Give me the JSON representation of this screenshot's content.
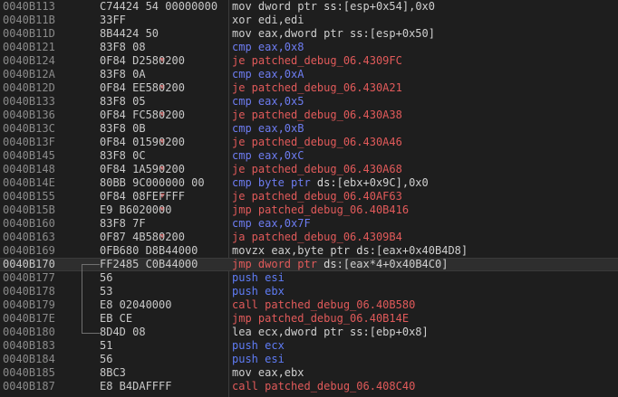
{
  "rows": [
    {
      "addr": "0040B113",
      "bytes": "C74424 54 00000000",
      "asm": [
        [
          "t-mn",
          "mov dword ptr "
        ],
        [
          "t-seg",
          "ss:"
        ],
        [
          "t-op",
          "[esp+0x54]"
        ],
        [
          "t-op",
          ",0x0"
        ]
      ]
    },
    {
      "addr": "0040B11B",
      "bytes": "33FF",
      "asm": [
        [
          "t-mn",
          "xor edi,edi"
        ]
      ]
    },
    {
      "addr": "0040B11D",
      "bytes": "8B4424 50",
      "asm": [
        [
          "t-mn",
          "mov eax,dword ptr "
        ],
        [
          "t-seg",
          "ss:"
        ],
        [
          "t-op",
          "[esp+0x50]"
        ]
      ]
    },
    {
      "addr": "0040B121",
      "bytes": "83F8 08",
      "asm": [
        [
          "t-cmp",
          "cmp eax,0x8"
        ]
      ]
    },
    {
      "addr": "0040B124",
      "bytes": "0F84 D2580200",
      "jcc": true,
      "asm": [
        [
          "t-jcc",
          "je patched_debug_06.4309FC"
        ]
      ]
    },
    {
      "addr": "0040B12A",
      "bytes": "83F8 0A",
      "asm": [
        [
          "t-cmp",
          "cmp eax,0xA"
        ]
      ]
    },
    {
      "addr": "0040B12D",
      "bytes": "0F84 EE580200",
      "jcc": true,
      "asm": [
        [
          "t-jcc",
          "je patched_debug_06.430A21"
        ]
      ]
    },
    {
      "addr": "0040B133",
      "bytes": "83F8 05",
      "asm": [
        [
          "t-cmp",
          "cmp eax,0x5"
        ]
      ]
    },
    {
      "addr": "0040B136",
      "bytes": "0F84 FC580200",
      "jcc": true,
      "asm": [
        [
          "t-jcc",
          "je patched_debug_06.430A38"
        ]
      ]
    },
    {
      "addr": "0040B13C",
      "bytes": "83F8 0B",
      "asm": [
        [
          "t-cmp",
          "cmp eax,0xB"
        ]
      ]
    },
    {
      "addr": "0040B13F",
      "bytes": "0F84 01590200",
      "jcc": true,
      "asm": [
        [
          "t-jcc",
          "je patched_debug_06.430A46"
        ]
      ]
    },
    {
      "addr": "0040B145",
      "bytes": "83F8 0C",
      "asm": [
        [
          "t-cmp",
          "cmp eax,0xC"
        ]
      ]
    },
    {
      "addr": "0040B148",
      "bytes": "0F84 1A590200",
      "jcc": true,
      "asm": [
        [
          "t-jcc",
          "je patched_debug_06.430A68"
        ]
      ]
    },
    {
      "addr": "0040B14E",
      "bytes": "80BB 9C000000 00",
      "asm": [
        [
          "t-cmp",
          "cmp byte ptr "
        ],
        [
          "t-seg",
          "ds:"
        ],
        [
          "t-op",
          "[ebx+0x9C],0x0"
        ]
      ]
    },
    {
      "addr": "0040B155",
      "bytes": "0F84 08FEFFFF",
      "jcc": true,
      "asm": [
        [
          "t-jcc",
          "je patched_debug_06.40AF63"
        ]
      ]
    },
    {
      "addr": "0040B15B",
      "bytes": "E9 B6020000",
      "jcc": true,
      "asm": [
        [
          "t-jmp",
          "jmp patched_debug_06.40B416"
        ]
      ]
    },
    {
      "addr": "0040B160",
      "bytes": "83F8 7F",
      "asm": [
        [
          "t-cmp",
          "cmp eax,0x7F"
        ]
      ]
    },
    {
      "addr": "0040B163",
      "bytes": "0F87 4B580200",
      "jcc": true,
      "asm": [
        [
          "t-jcc",
          "ja patched_debug_06.4309B4"
        ]
      ]
    },
    {
      "addr": "0040B169",
      "bytes": "0FB680 D8B44000",
      "asm": [
        [
          "t-mn",
          "movzx eax,byte ptr "
        ],
        [
          "t-seg",
          "ds:"
        ],
        [
          "t-op",
          "[eax+0x40B4D8]"
        ]
      ]
    },
    {
      "addr": "0040B170",
      "bytes": "FF2485 C0B44000",
      "sel": true,
      "asm": [
        [
          "t-jmp",
          "jmp dword ptr "
        ],
        [
          "t-seg",
          "ds:"
        ],
        [
          "t-op",
          "[eax*4+0x40B4C0]"
        ]
      ]
    },
    {
      "addr": "0040B177",
      "bytes": "56",
      "asm": [
        [
          "t-push",
          "push esi"
        ]
      ]
    },
    {
      "addr": "0040B178",
      "bytes": "53",
      "asm": [
        [
          "t-push",
          "push ebx"
        ]
      ]
    },
    {
      "addr": "0040B179",
      "bytes": "E8 02040000",
      "asm": [
        [
          "t-call",
          "call patched_debug_06.40B580"
        ]
      ]
    },
    {
      "addr": "0040B17E",
      "bytes": "EB CE",
      "asm": [
        [
          "t-jmp",
          "jmp patched_debug_06.40B14E"
        ]
      ]
    },
    {
      "addr": "0040B180",
      "bytes": "8D4D 08",
      "asm": [
        [
          "t-mn",
          "lea ecx,dword ptr "
        ],
        [
          "t-seg",
          "ss:"
        ],
        [
          "t-op",
          "[ebp+0x8]"
        ]
      ]
    },
    {
      "addr": "0040B183",
      "bytes": "51",
      "asm": [
        [
          "t-push",
          "push ecx"
        ]
      ]
    },
    {
      "addr": "0040B184",
      "bytes": "56",
      "asm": [
        [
          "t-push",
          "push esi"
        ]
      ]
    },
    {
      "addr": "0040B185",
      "bytes": "8BC3",
      "asm": [
        [
          "t-mn",
          "mov eax,ebx"
        ]
      ]
    },
    {
      "addr": "0040B187",
      "bytes": "E8 B4DAFFFF",
      "asm": [
        [
          "t-call",
          "call patched_debug_06.408C40"
        ]
      ]
    }
  ]
}
